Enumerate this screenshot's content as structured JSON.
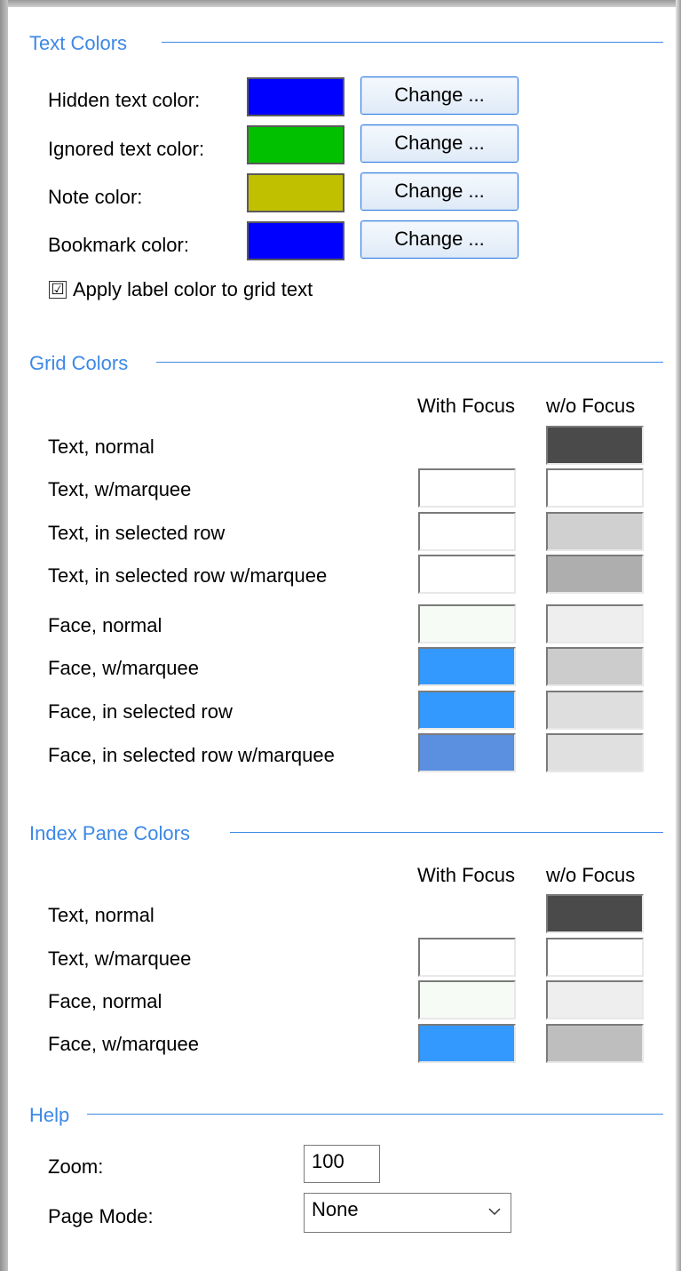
{
  "text_colors": {
    "title": "Text Colors",
    "rows": [
      {
        "label": "Hidden text color:",
        "color": "#0000ff",
        "button": "Change ..."
      },
      {
        "label": "Ignored text color:",
        "color": "#00c000",
        "button": "Change ..."
      },
      {
        "label": "Note color:",
        "color": "#c0c000",
        "button": "Change ..."
      },
      {
        "label": "Bookmark color:",
        "color": "#0000ff",
        "button": "Change ..."
      }
    ],
    "apply_label_checkbox": {
      "label": "Apply label color to grid text",
      "checked": true,
      "mark": "☑"
    }
  },
  "grid_colors": {
    "title": "Grid Colors",
    "col_with_focus": "With Focus",
    "col_without_focus": "w/o Focus",
    "rows": [
      {
        "label": "Text, normal",
        "with_focus": null,
        "without_focus": "#4a4a4a"
      },
      {
        "label": "Text, w/marquee",
        "with_focus": "#ffffff",
        "without_focus": "#ffffff"
      },
      {
        "label": "Text, in selected row",
        "with_focus": "#ffffff",
        "without_focus": "#d0d0d0"
      },
      {
        "label": "Text, in selected row w/marquee",
        "with_focus": "#ffffff",
        "without_focus": "#aeaeae"
      },
      {
        "label": "Face, normal",
        "with_focus": "#f6fbf6",
        "without_focus": "#eeeeee"
      },
      {
        "label": "Face, w/marquee",
        "with_focus": "#3399ff",
        "without_focus": "#cccccc"
      },
      {
        "label": "Face, in selected row",
        "with_focus": "#3399ff",
        "without_focus": "#dedede"
      },
      {
        "label": "Face, in selected row w/marquee",
        "with_focus": "#5b8fe0",
        "without_focus": "#e0e0e0"
      }
    ]
  },
  "index_pane_colors": {
    "title": "Index Pane Colors",
    "col_with_focus": "With Focus",
    "col_without_focus": "w/o Focus",
    "rows": [
      {
        "label": "Text, normal",
        "with_focus": null,
        "without_focus": "#4a4a4a"
      },
      {
        "label": "Text, w/marquee",
        "with_focus": "#ffffff",
        "without_focus": "#ffffff"
      },
      {
        "label": "Face, normal",
        "with_focus": "#f6fbf6",
        "without_focus": "#eeeeee"
      },
      {
        "label": "Face, w/marquee",
        "with_focus": "#3399ff",
        "without_focus": "#bebebe"
      }
    ]
  },
  "help": {
    "title": "Help",
    "zoom_label": "Zoom:",
    "zoom_value": "100",
    "page_mode_label": "Page Mode:",
    "page_mode_value": "None",
    "dropdown_icon": "chevron-down-icon"
  },
  "accent_color": "#3c88e6"
}
